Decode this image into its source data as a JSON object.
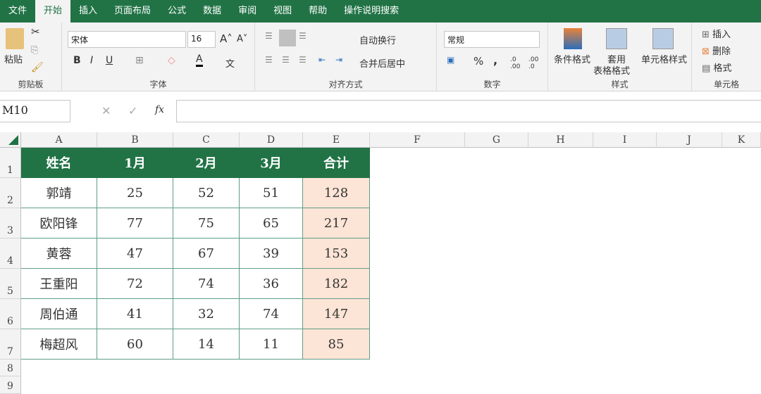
{
  "menu": [
    "文件",
    "开始",
    "插入",
    "页面布局",
    "公式",
    "数据",
    "审阅",
    "视图",
    "帮助",
    "操作说明搜索"
  ],
  "ribbon": {
    "clipboard": {
      "paste": "粘贴",
      "label": "剪贴板"
    },
    "font": {
      "name": "宋体",
      "size": "16",
      "bold": "B",
      "italic": "I",
      "underline": "U",
      "label": "字体",
      "font_color": "A",
      "phonetic": "文"
    },
    "alignment": {
      "wrap": "自动换行",
      "merge": "合并后居中",
      "label": "对齐方式"
    },
    "number": {
      "format": "常规",
      "percent": "%",
      "comma": ",",
      "label": "数字"
    },
    "styles": {
      "conditional": "条件格式",
      "table1": "套用",
      "table2": "表格格式",
      "cell_styles": "单元格样式",
      "label": "样式"
    },
    "cells": {
      "insert": "插入",
      "delete": "删除",
      "format": "格式",
      "label": "单元格"
    }
  },
  "formula_bar": {
    "name_box": "M10",
    "fx": "fx",
    "value": ""
  },
  "columns": [
    "A",
    "B",
    "C",
    "D",
    "E",
    "F",
    "G",
    "H",
    "I",
    "J",
    "K"
  ],
  "rows": [
    "1",
    "2",
    "3",
    "4",
    "5",
    "6",
    "7",
    "8",
    "9"
  ],
  "table": {
    "headers": [
      "姓名",
      "1月",
      "2月",
      "3月",
      "合计"
    ],
    "rows": [
      [
        "郭靖",
        "25",
        "52",
        "51",
        "128"
      ],
      [
        "欧阳锋",
        "77",
        "75",
        "65",
        "217"
      ],
      [
        "黄蓉",
        "47",
        "67",
        "39",
        "153"
      ],
      [
        "王重阳",
        "72",
        "74",
        "36",
        "182"
      ],
      [
        "周伯通",
        "41",
        "32",
        "74",
        "147"
      ],
      [
        "梅超风",
        "60",
        "14",
        "11",
        "85"
      ]
    ]
  },
  "colors": {
    "accent": "#217346",
    "total_fill": "#fce4d6"
  }
}
